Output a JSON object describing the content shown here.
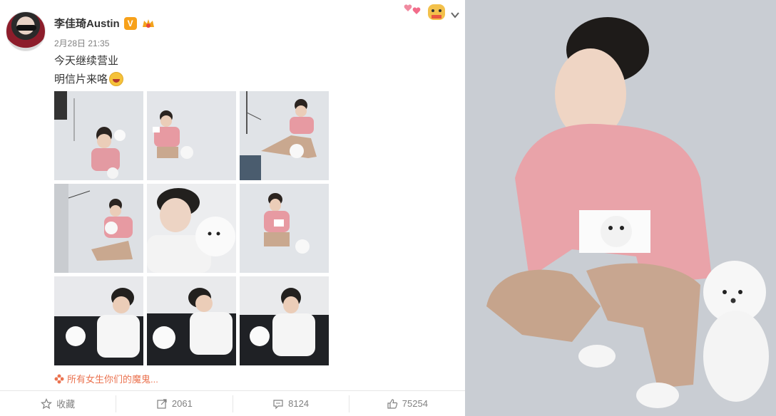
{
  "post": {
    "author": "李佳琦Austin",
    "verified_badge": "V",
    "time": "2月28日 21:35",
    "text_line1": "今天继续营业",
    "text_line2": "明信片来咯",
    "photos": [
      {
        "name": "photo-1",
        "kind": "studio-pink-sitting"
      },
      {
        "name": "photo-2",
        "kind": "studio-pink-crouch"
      },
      {
        "name": "photo-3",
        "kind": "studio-pink-lying"
      },
      {
        "name": "photo-4",
        "kind": "studio-pink-sitting-dog"
      },
      {
        "name": "photo-5",
        "kind": "closeup-white-dog"
      },
      {
        "name": "photo-6",
        "kind": "studio-pink-crouch-card"
      },
      {
        "name": "photo-7",
        "kind": "sofa-white-dog"
      },
      {
        "name": "photo-8",
        "kind": "sofa-white-dog-2"
      },
      {
        "name": "photo-9",
        "kind": "sofa-white-dog-3"
      }
    ],
    "topic": "所有女生你们的魔鬼..."
  },
  "actions": {
    "favorite_label": "收藏",
    "repost_count": "2061",
    "comment_count": "8124",
    "like_count": "75254"
  },
  "colors": {
    "accent": "#eb7350",
    "badge": "#f7a11a",
    "muted": "#808080",
    "divider": "#e6e6e6"
  },
  "icons": [
    "star-icon",
    "repost-icon",
    "comment-icon",
    "like-icon",
    "chevron-down-icon",
    "topic-flower-icon"
  ]
}
